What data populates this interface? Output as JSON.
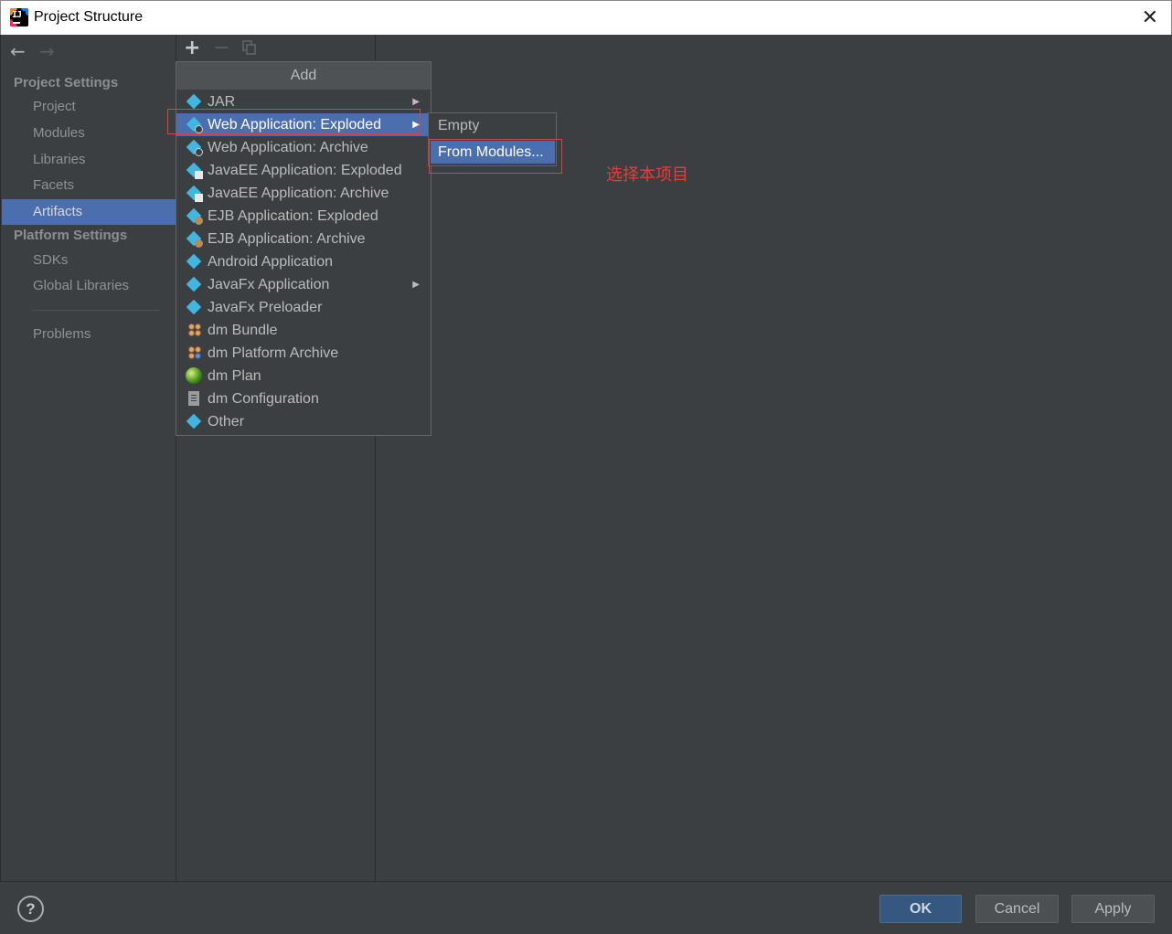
{
  "window": {
    "title": "Project Structure",
    "close_glyph": "✕"
  },
  "nav": {
    "back": "←",
    "forward": "→"
  },
  "sidebar": {
    "project_settings_header": "Project Settings",
    "platform_settings_header": "Platform Settings",
    "items": [
      {
        "label": "Project"
      },
      {
        "label": "Modules"
      },
      {
        "label": "Libraries"
      },
      {
        "label": "Facets"
      },
      {
        "label": "Artifacts",
        "selected": true
      },
      {
        "label": "SDKs"
      },
      {
        "label": "Global Libraries"
      },
      {
        "label": "Problems"
      }
    ]
  },
  "toolbar": {
    "add": "+",
    "remove": "−"
  },
  "add_popup": {
    "title": "Add",
    "items": [
      {
        "label": "JAR",
        "icon": "artifact-icon",
        "submenu": true
      },
      {
        "label": "Web Application: Exploded",
        "icon": "web-artifact-icon",
        "submenu": true,
        "highlighted": true
      },
      {
        "label": "Web Application: Archive",
        "icon": "web-artifact-icon"
      },
      {
        "label": "JavaEE Application: Exploded",
        "icon": "javaee-artifact-icon"
      },
      {
        "label": "JavaEE Application: Archive",
        "icon": "javaee-artifact-icon"
      },
      {
        "label": "EJB Application: Exploded",
        "icon": "ejb-artifact-icon"
      },
      {
        "label": "EJB Application: Archive",
        "icon": "ejb-artifact-icon"
      },
      {
        "label": "Android Application",
        "icon": "artifact-icon"
      },
      {
        "label": "JavaFx Application",
        "icon": "artifact-icon",
        "submenu": true
      },
      {
        "label": "JavaFx Preloader",
        "icon": "artifact-icon"
      },
      {
        "label": "dm Bundle",
        "icon": "bundle-icon"
      },
      {
        "label": "dm Platform Archive",
        "icon": "bundle-icon"
      },
      {
        "label": "dm Plan",
        "icon": "plan-icon"
      },
      {
        "label": "dm Configuration",
        "icon": "config-file-icon"
      },
      {
        "label": "Other",
        "icon": "artifact-icon"
      }
    ],
    "submenu_arrow": "▶"
  },
  "submenu": {
    "items": [
      {
        "label": "Empty"
      },
      {
        "label": "From Modules...",
        "highlighted": true
      }
    ]
  },
  "annotation": {
    "text": "选择本项目",
    "color": "#e53f35"
  },
  "footer": {
    "help": "?",
    "ok": "OK",
    "cancel": "Cancel",
    "apply": "Apply"
  },
  "colors": {
    "selection": "#4b6eaf",
    "background": "#3c3f41",
    "ok_button": "#365880"
  }
}
